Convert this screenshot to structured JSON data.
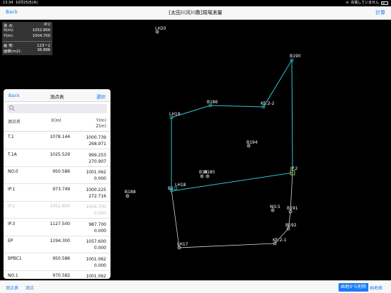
{
  "status": {
    "time": "13:34",
    "date": "10月25日(木)",
    "charging": "充電していません"
  },
  "nav": {
    "back": "Back",
    "title": "[太田川河川敷]現場測量",
    "calc": "計算"
  },
  "info": {
    "rows": [
      {
        "k": "測 点:",
        "v": "IP.2"
      },
      {
        "k": "X(m):",
        "v": "1052.800"
      },
      {
        "k": "Y(m):",
        "v": "1004.700"
      },
      {
        "k": "画 地:",
        "v": "123ー2"
      },
      {
        "k": "面積(m2):",
        "v": "36.886"
      }
    ]
  },
  "panel": {
    "back": "Back",
    "title": "測点表",
    "select": "選択",
    "search_placeholder": "",
    "headers": {
      "name": "測点名",
      "x": "X(m)",
      "y": "Y(m)",
      "z": "Z(m)"
    },
    "rows": [
      {
        "name": "T.1",
        "x": "1078.144",
        "y": "1000.739",
        "z": "268.971",
        "dim": false
      },
      {
        "name": "T.1A",
        "x": "1025.529",
        "y": "999.253",
        "z": "270.907",
        "dim": false
      },
      {
        "name": "NO.0",
        "x": "950.586",
        "y": "1001.062",
        "z": "0.000",
        "dim": false
      },
      {
        "name": "IP.1",
        "x": "973.749",
        "y": "1000.225",
        "z": "272.716",
        "dim": false
      },
      {
        "name": "IP.2",
        "x": "1052.800",
        "y": "1004.700",
        "z": "0.000",
        "dim": true
      },
      {
        "name": "IP.3",
        "x": "1127.500",
        "y": "987.700",
        "z": "0.000",
        "dim": false
      },
      {
        "name": "EP",
        "x": "1194.300",
        "y": "1057.600",
        "z": "0.000",
        "dim": false
      },
      {
        "name": "BPBC1",
        "x": "950.586",
        "y": "1001.062",
        "z": "0.000",
        "dim": false
      },
      {
        "name": "NO.1",
        "x": "970.582",
        "y": "1001.062",
        "z": "",
        "dim": false
      }
    ]
  },
  "map": {
    "points": [
      {
        "name": "LH20",
        "kind": "survey"
      },
      {
        "name": "B190",
        "kind": "vertex"
      },
      {
        "name": "B186",
        "kind": "vertex"
      },
      {
        "name": "KE.2-2",
        "kind": "vertex"
      },
      {
        "name": "LH19",
        "kind": "vertex"
      },
      {
        "name": "B194",
        "kind": "survey"
      },
      {
        "name": "IP.2",
        "kind": "selected"
      },
      {
        "name": "B18",
        "kind": "survey"
      },
      {
        "name": "B185",
        "kind": "survey"
      },
      {
        "name": "LH18",
        "kind": "vertex"
      },
      {
        "name": "B1",
        "kind": "vertex"
      },
      {
        "name": "B188",
        "kind": "survey"
      },
      {
        "name": "NO.5",
        "kind": "survey"
      },
      {
        "name": "B191",
        "kind": "vertex"
      },
      {
        "name": "B192",
        "kind": "vertex"
      },
      {
        "name": "KE.2-1",
        "kind": "vertex"
      },
      {
        "name": "LH17",
        "kind": "vertex"
      }
    ]
  },
  "bottom": {
    "table": "測点表",
    "points": "測点",
    "remove": "画地から削除",
    "lot_table": "画地表"
  },
  "colors": {
    "accent": "#1a7cf5",
    "boundary": "#2ec4d6",
    "line": "#d8d8d8",
    "selected": "#c8c832"
  }
}
